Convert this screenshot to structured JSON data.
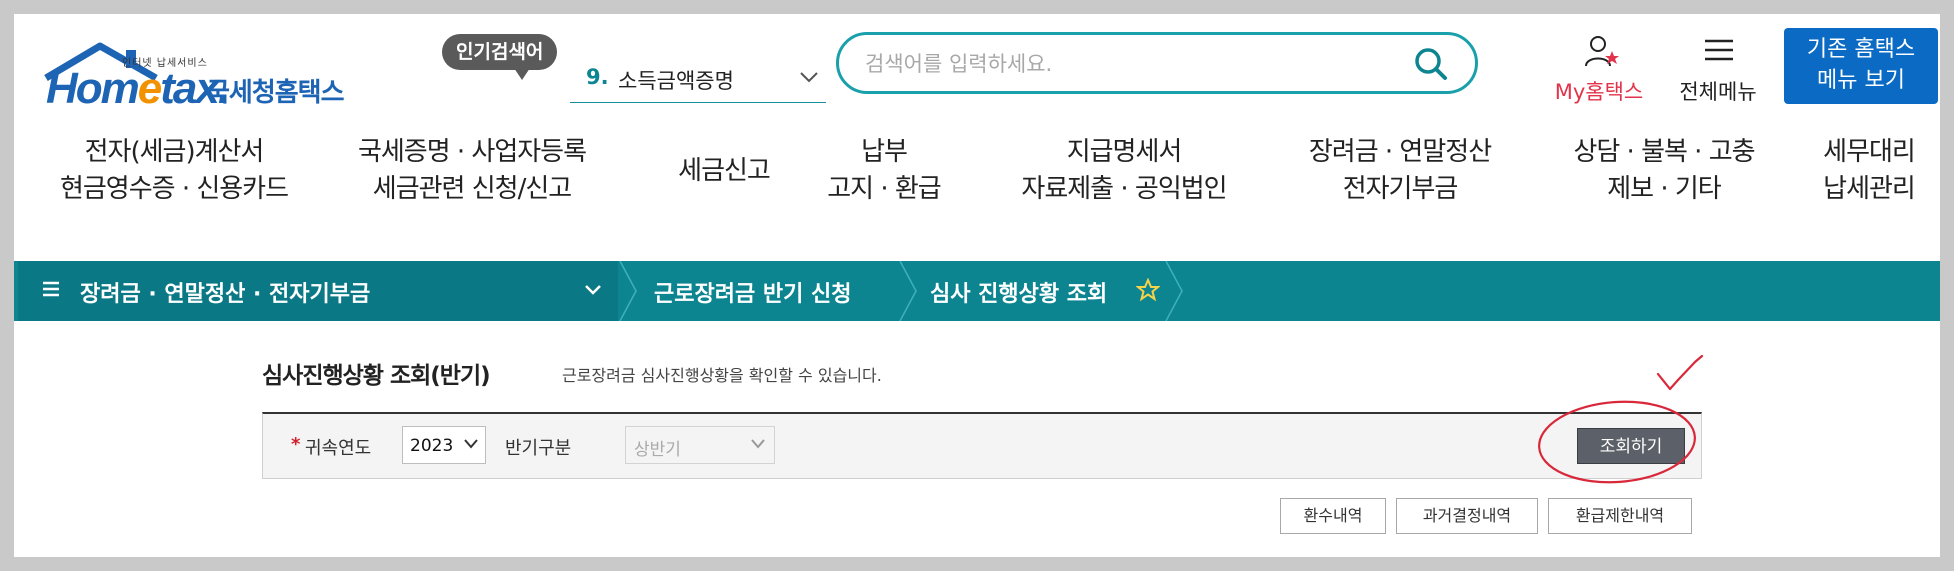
{
  "header": {
    "logo": {
      "tagline": "인터넷 납세서비스",
      "wordmark_pre": "Hom",
      "wordmark_e": "e",
      "wordmark_post": "tax.",
      "korean": "국세청홈택스"
    },
    "popular_search": {
      "badge": "인기검색어",
      "rank": "9.",
      "keyword": "소득금액증명"
    },
    "search": {
      "placeholder": "검색어를 입력하세요."
    },
    "my_hometax_label": "My홈택스",
    "all_menu_label": "전체메뉴",
    "legacy_button": {
      "line1": "기존 홈택스",
      "line2": "메뉴 보기"
    }
  },
  "main_nav": [
    {
      "line1": "전자(세금)계산서",
      "line2": "현금영수증 · 신용카드"
    },
    {
      "line1": "국세증명 · 사업자등록",
      "line2": "세금관련 신청/신고"
    },
    {
      "line1": "세금신고",
      "line2": ""
    },
    {
      "line1": "납부",
      "line2": "고지 · 환급"
    },
    {
      "line1": "지급명세서",
      "line2": "자료제출 · 공익법인"
    },
    {
      "line1": "장려금 · 연말정산",
      "line2": "전자기부금"
    },
    {
      "line1": "상담 · 불복 · 고충",
      "line2": "제보 · 기타"
    },
    {
      "line1": "세무대리",
      "line2": "납세관리"
    }
  ],
  "breadcrumb": {
    "section": "장려금 · 연말정산 · 전자기부금",
    "level2": "근로장려금 반기 신청",
    "level3": "심사 진행상황 조회"
  },
  "content": {
    "title": "심사진행상황 조회(반기)",
    "description": "근로장려금 심사진행상황을 확인할 수 있습니다.",
    "filter": {
      "required_mark": "*",
      "year_label": "귀속연도",
      "year_value": "2023",
      "half_label": "반기구분",
      "half_value": "상반기",
      "search_button": "조회하기"
    },
    "buttons": [
      "환수내역",
      "과거결정내역",
      "환급제한내역"
    ]
  },
  "colors": {
    "teal_bar": "#0d8591",
    "brand_blue": "#1e64b4",
    "accent_orange": "#f29200",
    "my_hometax_red": "#e2334b",
    "annotation_red": "#d8283a"
  }
}
